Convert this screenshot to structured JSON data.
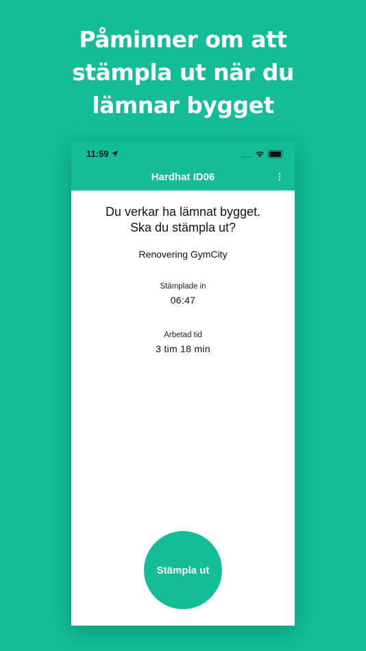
{
  "promo": {
    "lines": [
      "Påminner om att",
      "stämpla ut när du",
      "lämnar bygget"
    ]
  },
  "status_bar": {
    "time": "11:59",
    "icons": [
      "location-arrow-icon",
      "signal-icon",
      "wifi-icon",
      "battery-icon"
    ]
  },
  "app_bar": {
    "title": "Hardhat ID06",
    "menu_icon": "more-vertical-icon"
  },
  "prompt": {
    "line1": "Du verkar ha lämnat bygget.",
    "line2": "Ska du stämpla ut?"
  },
  "project_name": "Renovering GymCity",
  "stamped_in": {
    "label": "Stämplade in",
    "value": "06:47"
  },
  "worked_time": {
    "label": "Arbetad tid",
    "value": "3 tim 18 min"
  },
  "stamp_out_button": "Stämpla ut",
  "colors": {
    "brand": "#12bd98",
    "surface": "#ffffff",
    "text": "#111111"
  }
}
